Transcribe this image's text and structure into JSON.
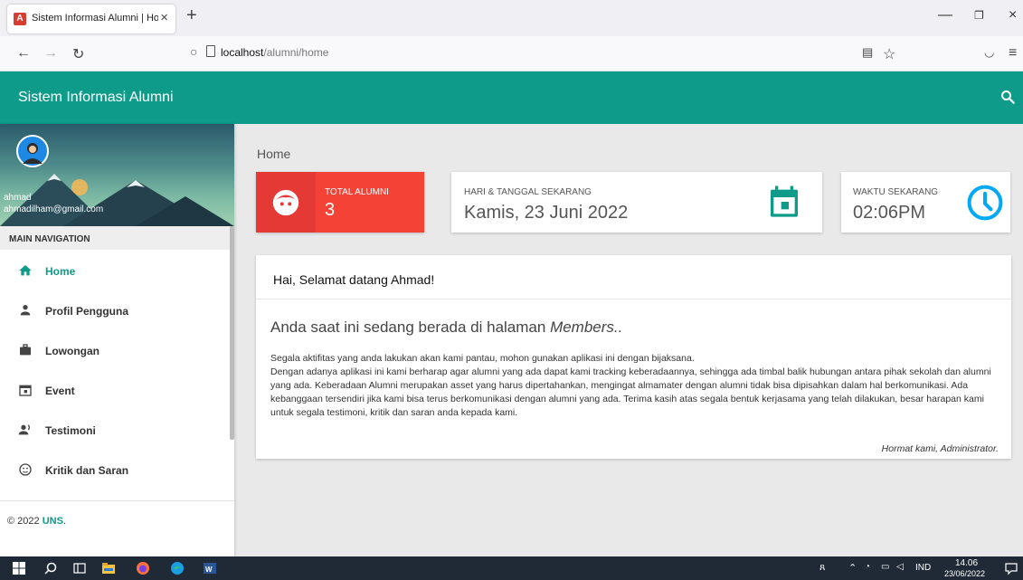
{
  "browser": {
    "tab_title": "Sistem Informasi Alumni | Hom",
    "tab_favicon_letter": "A",
    "url_host": "localhost",
    "url_path": "/alumni/home"
  },
  "app": {
    "title": "Sistem Informasi Alumni",
    "accent_color": "#0f9b8a"
  },
  "user": {
    "name": "ahmad",
    "email": "ahmadilham@gmail.com"
  },
  "sidebar": {
    "nav_header": "MAIN NAVIGATION",
    "items": [
      {
        "label": "Home",
        "icon": "home-icon",
        "active": true
      },
      {
        "label": "Profil Pengguna",
        "icon": "person-icon",
        "active": false
      },
      {
        "label": "Lowongan",
        "icon": "briefcase-icon",
        "active": false
      },
      {
        "label": "Event",
        "icon": "calendar-icon",
        "active": false
      },
      {
        "label": "Testimoni",
        "icon": "record-voice-icon",
        "active": false
      },
      {
        "label": "Kritik dan Saran",
        "icon": "smiley-icon",
        "active": false
      }
    ],
    "footer_copy": "© 2022 ",
    "footer_link": "UNS",
    "footer_suffix": "."
  },
  "main": {
    "heading": "Home",
    "total_alumni": {
      "label": "TOTAL ALUMNI",
      "value": "3",
      "color": "#f44336"
    },
    "date_box": {
      "label": "HARI & TANGGAL SEKARANG",
      "value": "Kamis, 23 Juni 2022",
      "icon_color": "#0f9b8a"
    },
    "time_box": {
      "label": "WAKTU SEKARANG",
      "value": "02:06PM",
      "icon_color": "#03a9f4"
    },
    "welcome": {
      "title": "Hai, Selamat datang Ahmad!",
      "lead_prefix": "Anda saat ini sedang berada di halaman ",
      "lead_em": "Members..",
      "p1": "Segala aktifitas yang anda lakukan akan kami pantau, mohon gunakan aplikasi ini dengan bijaksana.",
      "p2": "Dengan adanya aplikasi ini kami berharap agar alumni yang ada dapat kami tracking keberadaannya, sehingga ada timbal balik hubungan antara pihak sekolah dan alumni yang ada. Keberadaan Alumni merupakan asset yang harus dipertahankan, mengingat almamater dengan alumni tidak bisa dipisahkan dalam hal berkomunikasi. Ada kebanggaan tersendiri jika kami bisa terus berkomunikasi dengan alumni yang ada. Terima kasih atas segala bentuk kerjasama yang telah dilakukan, besar harapan kami untuk segala testimoni, kritik dan saran anda kepada kami.",
      "signature": "Hormat kami, Administrator."
    }
  },
  "taskbar": {
    "language": "IND",
    "time": "14.06",
    "date": "23/06/2022"
  }
}
